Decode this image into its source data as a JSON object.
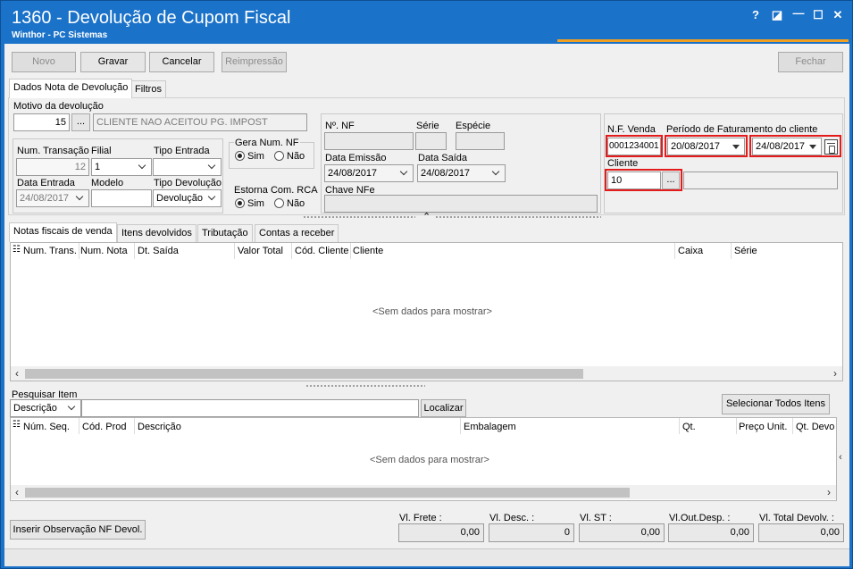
{
  "window": {
    "title": "1360 - Devolução de Cupom Fiscal",
    "subtitle": "Winthor - PC Sistemas",
    "help_glyph": "?",
    "restore_glyph": "◪",
    "minimize_glyph": "—",
    "maximize_glyph": "☐",
    "close_glyph": "✕"
  },
  "toolbar": {
    "novo": "Novo",
    "gravar": "Gravar",
    "cancelar": "Cancelar",
    "reimpressao": "Reimpressão",
    "fechar": "Fechar"
  },
  "top_tabs": [
    "Dados Nota de Devolução",
    "Filtros"
  ],
  "motivo": {
    "label": "Motivo da devolução",
    "code": "15",
    "btn": "...",
    "desc": "CLIENTE NAO ACEITOU PG. IMPOST"
  },
  "left_box": {
    "num_transacao_label": "Num. Transação",
    "num_transacao": "12",
    "filial_label": "Filial",
    "filial": "1",
    "tipo_entrada_label": "Tipo Entrada",
    "tipo_entrada": "",
    "data_entrada_label": "Data Entrada",
    "data_entrada": "24/08/2017",
    "modelo_label": "Modelo",
    "modelo": "",
    "tipo_devolucao_label": "Tipo Devolução",
    "tipo_devolucao": "Devolução"
  },
  "gera_num": {
    "label": "Gera Num. NF",
    "sim": "Sim",
    "nao": "Não"
  },
  "estorna": {
    "label": "Estorna Com. RCA",
    "sim": "Sim",
    "nao": "Não"
  },
  "nf_box": {
    "num_nf_label": "Nº. NF",
    "serie_label": "Série",
    "especie_label": "Espécie",
    "data_emissao_label": "Data Emissão",
    "data_emissao": "24/08/2017",
    "data_saida_label": "Data Saída",
    "data_saida": "24/08/2017",
    "chave_label": "Chave NFe"
  },
  "right_box": {
    "nf_venda_label": "N.F. Venda",
    "nf_venda": "0001234001",
    "periodo_label": "Período de Faturamento do cliente",
    "periodo_ini": "20/08/2017",
    "periodo_fim": "24/08/2017",
    "cliente_label": "Cliente",
    "cliente": "10",
    "cliente_btn": "..."
  },
  "grid_tabs": [
    "Notas fiscais de venda",
    "Itens devolvidos",
    "Tributação",
    "Contas a receber"
  ],
  "grid1": {
    "columns": [
      "Num. Trans.",
      "Num. Nota",
      "Dt. Saída",
      "Valor Total",
      "Cód. Cliente",
      "Cliente",
      "Caixa",
      "Série"
    ],
    "empty": "<Sem dados para mostrar>"
  },
  "pesquisa": {
    "label": "Pesquisar Item",
    "field": "Descrição",
    "text": "",
    "localizar": "Localizar",
    "selecionar": "Selecionar Todos Itens"
  },
  "grid2": {
    "columns": [
      "Núm. Seq.",
      "Cód. Prod",
      "Descrição",
      "Embalagem",
      "Qt.",
      "Preço Unit.",
      "Qt. Devo"
    ],
    "empty": "<Sem dados para mostrar>"
  },
  "footer": {
    "inserir_obs": "Inserir Observação NF Devol.",
    "totals": [
      {
        "label": "Vl. Frete :",
        "value": "0,00"
      },
      {
        "label": "Vl. Desc. :",
        "value": "0"
      },
      {
        "label": "Vl. ST :",
        "value": "0,00"
      },
      {
        "label": "Vl.Out.Desp. :",
        "value": "0,00"
      },
      {
        "label": "Vl. Total Devolv. :",
        "value": "0,00"
      }
    ]
  }
}
